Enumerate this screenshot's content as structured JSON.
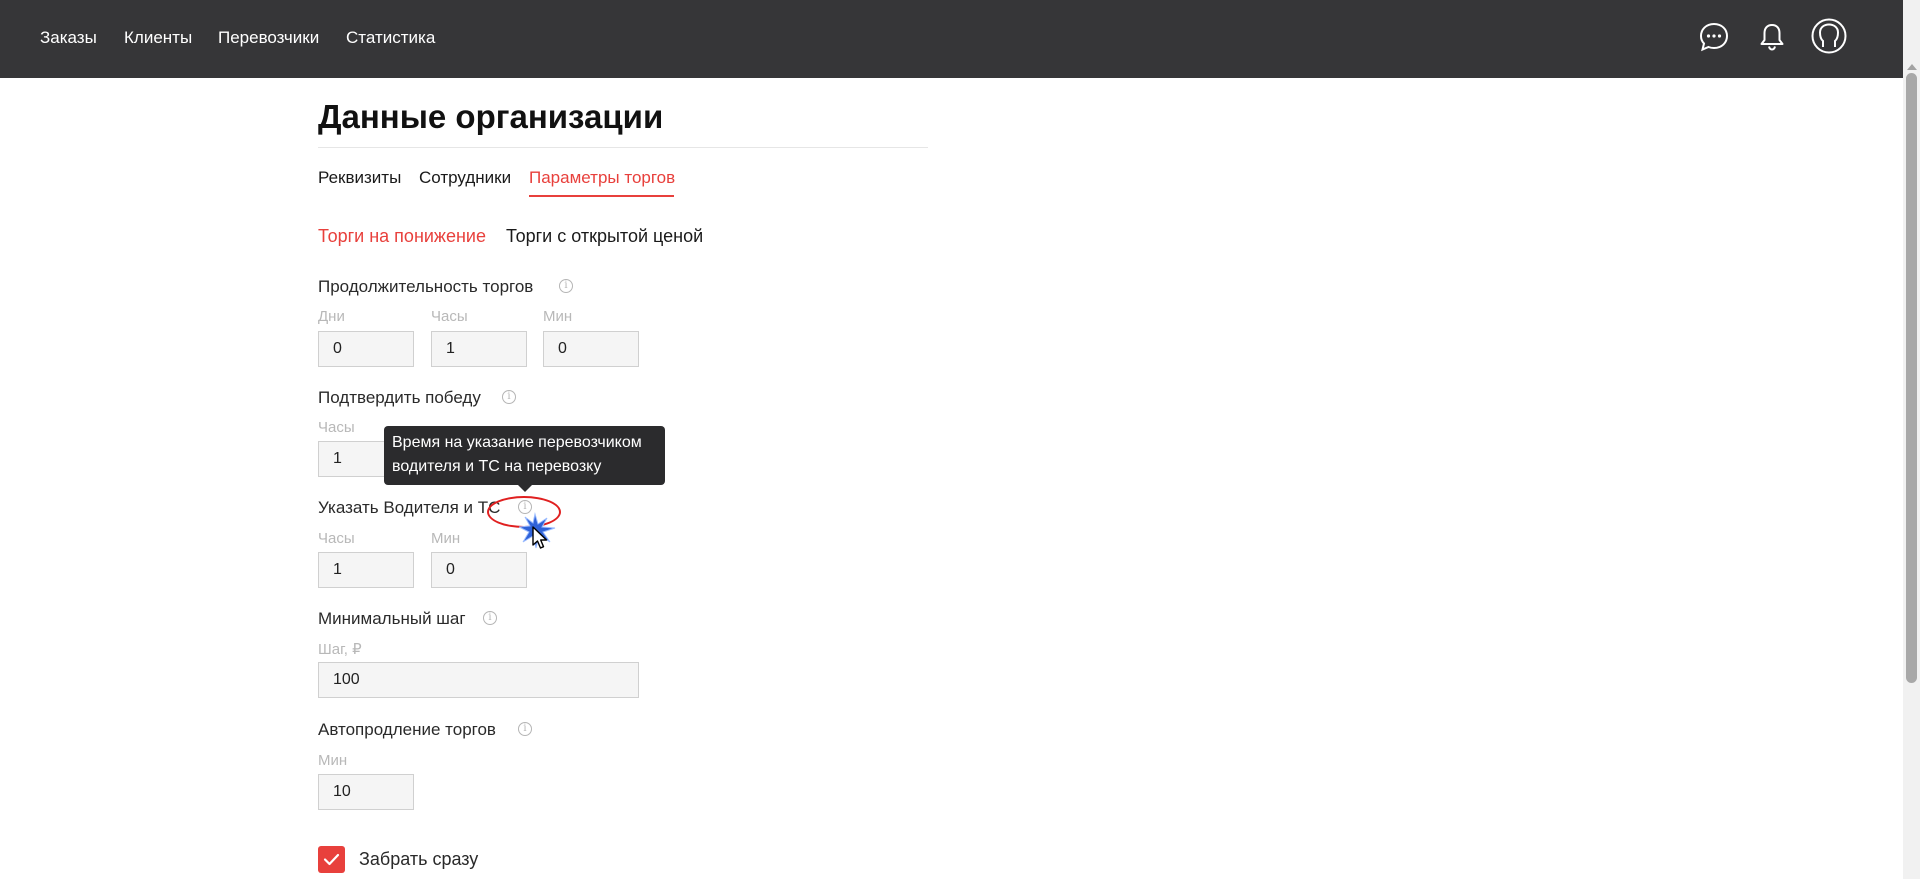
{
  "nav": {
    "items": [
      {
        "label": "Заказы"
      },
      {
        "label": "Клиенты"
      },
      {
        "label": "Перевозчики"
      },
      {
        "label": "Статистика"
      }
    ],
    "icons": [
      "chat-icon",
      "bell-icon",
      "user-icon"
    ]
  },
  "page": {
    "title": "Данные организации"
  },
  "tabs": [
    {
      "label": "Реквизиты",
      "active": false
    },
    {
      "label": "Сотрудники",
      "active": false
    },
    {
      "label": "Параметры торгов",
      "active": true
    }
  ],
  "subtabs": [
    {
      "label": "Торги на понижение",
      "active": true
    },
    {
      "label": "Торги с открытой ценой",
      "active": false
    }
  ],
  "sections": {
    "duration": {
      "label": "Продолжительность торгов",
      "fields": [
        {
          "label": "Дни",
          "value": "0"
        },
        {
          "label": "Часы",
          "value": "1"
        },
        {
          "label": "Мин",
          "value": "0"
        }
      ]
    },
    "confirm": {
      "label": "Подтвердить победу",
      "fields": [
        {
          "label": "Часы",
          "value": "1"
        }
      ]
    },
    "driver": {
      "label": "Указать Водителя и ТС",
      "fields": [
        {
          "label": "Часы",
          "value": "1"
        },
        {
          "label": "Мин",
          "value": "0"
        }
      ]
    },
    "min_step": {
      "label": "Минимальный шаг",
      "fields": [
        {
          "label": "Шаг, ₽",
          "value": "100"
        }
      ]
    },
    "auto_extend": {
      "label": "Автопродление торгов",
      "fields": [
        {
          "label": "Мин",
          "value": "10"
        }
      ]
    }
  },
  "tooltip": {
    "line1": "Время на указание перевозчиком",
    "line2": "водителя и ТС на перевозку"
  },
  "checkbox": {
    "label": "Забрать сразу",
    "checked": true
  },
  "colors": {
    "accent": "#e8403c",
    "topbar": "#363638"
  }
}
